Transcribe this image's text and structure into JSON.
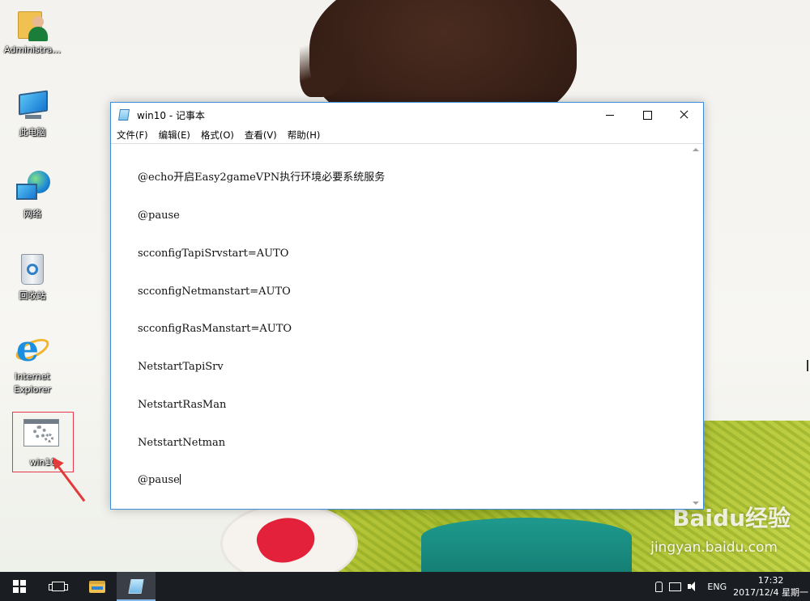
{
  "desktop": {
    "icons": [
      {
        "label": "Administra...",
        "icon": "user-folder-icon"
      },
      {
        "label": "此电脑",
        "icon": "computer-icon"
      },
      {
        "label": "网络",
        "icon": "network-icon"
      },
      {
        "label": "回收站",
        "icon": "recycle-bin-icon"
      },
      {
        "label": "Internet Explorer",
        "icon": "internet-explorer-icon"
      },
      {
        "label": "win10",
        "icon": "batch-file-icon"
      }
    ],
    "selection_color": "#e8374a",
    "watermark": "Baidu经验",
    "watermark_sub": "jingyan.baidu.com"
  },
  "window": {
    "title": "win10 - 记事本",
    "accent": "#3d8ed8",
    "menu": [
      "文件(F)",
      "编辑(E)",
      "格式(O)",
      "查看(V)",
      "帮助(H)"
    ],
    "lines": [
      "@echo开启Easy2gameVPN执行环境必要系统服务",
      "@pause",
      "scconfigTapiSrvstart=AUTO",
      "scconfigNetmanstart=AUTO",
      "scconfigRasManstart=AUTO",
      "NetstartTapiSrv",
      "NetstartRasMan",
      "NetstartNetman",
      "@pause"
    ]
  },
  "taskbar": {
    "background": "#1a1d22",
    "language": "ENG",
    "time": "17:32",
    "date": "2017/12/4 星期一"
  }
}
